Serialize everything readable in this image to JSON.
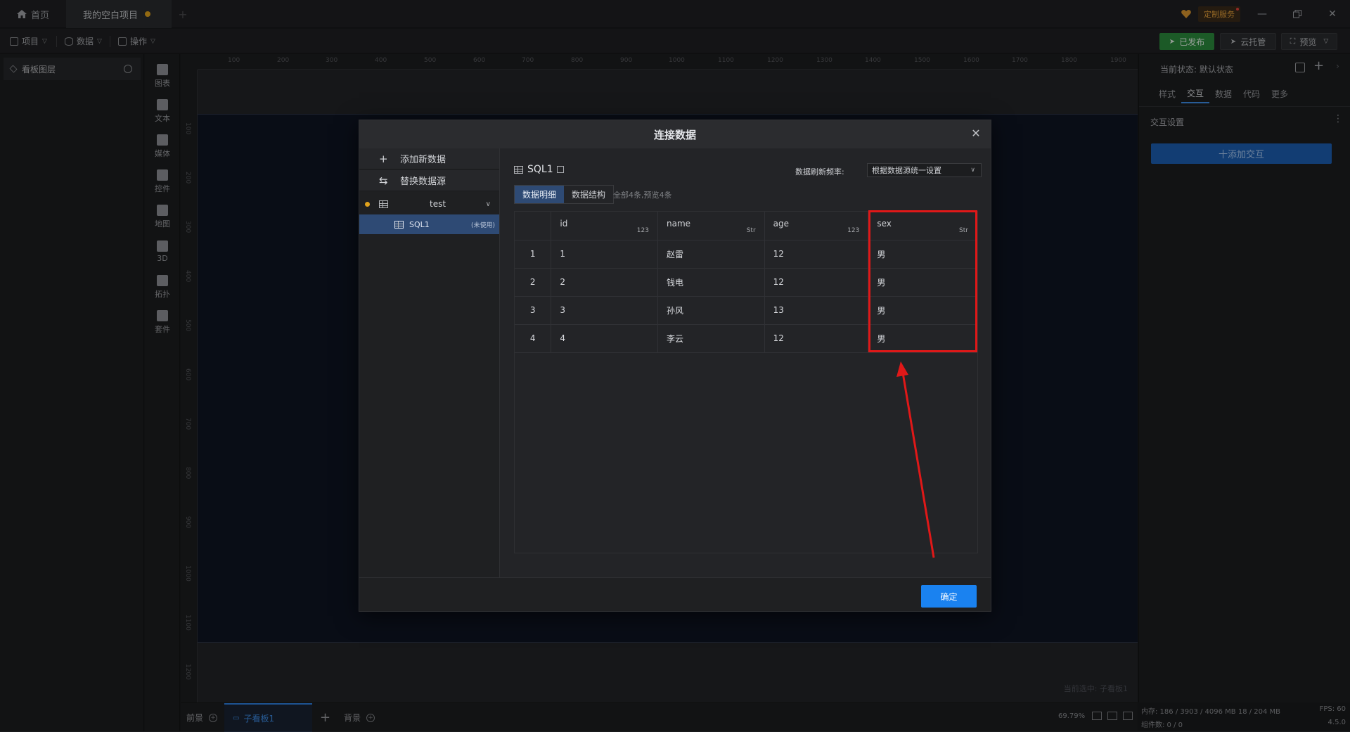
{
  "titlebar": {
    "home_tab": "首页",
    "project_tab": "我的空白项目",
    "custom_service": "定制服务"
  },
  "toolbar": {
    "menu_project": "项目",
    "menu_data": "数据",
    "menu_operate": "操作",
    "published": "已发布",
    "cloud_host": "云托管",
    "preview": "预览"
  },
  "layers": {
    "title": "看板图层"
  },
  "components": [
    {
      "label": "图表",
      "icon": "chart-icon"
    },
    {
      "label": "文本",
      "icon": "text-icon"
    },
    {
      "label": "媒体",
      "icon": "media-icon"
    },
    {
      "label": "控件",
      "icon": "control-icon"
    },
    {
      "label": "地图",
      "icon": "map-icon"
    },
    {
      "label": "3D",
      "icon": "cube-icon"
    },
    {
      "label": "拓扑",
      "icon": "topology-icon"
    },
    {
      "label": "套件",
      "icon": "suite-icon"
    }
  ],
  "ruler": {
    "top": [
      "100",
      "200",
      "300",
      "400",
      "500",
      "600",
      "700",
      "800",
      "900",
      "1000",
      "1100",
      "1200",
      "1300",
      "1400",
      "1500",
      "1600",
      "1700",
      "1800",
      "1900"
    ],
    "left": [
      "100",
      "200",
      "300",
      "400",
      "500",
      "600",
      "700",
      "800",
      "900",
      "1000",
      "1100",
      "1200"
    ]
  },
  "canvas": {
    "selected_label": "当前选中: 子看板1"
  },
  "bottom": {
    "front": "前景",
    "sub_board": "子看板1",
    "background": "背景",
    "zoom": "69.79%",
    "memory": "内存: 186 / 3903 / 4096 MB  18 / 204 MB",
    "fps": "FPS: 60",
    "components": "组件数: 0 / 0",
    "version": "4.5.0"
  },
  "right_panel": {
    "state": "当前状态: 默认状态",
    "tabs": [
      "样式",
      "交互",
      "数据",
      "代码",
      "更多"
    ],
    "active_tab": "交互",
    "section": "交互设置",
    "add_interaction": "十添加交互"
  },
  "modal": {
    "title": "连接数据",
    "add_data": "添加新数据",
    "replace_source": "替换数据源",
    "source_name": "test",
    "sql_name": "SQL1",
    "sql_status": "(未使用)",
    "sql_title": "SQL1",
    "refresh_label": "数据刷新频率:",
    "refresh_value": "根据数据源统一设置",
    "tab_detail": "数据明细",
    "tab_structure": "数据结构",
    "count": "全部4条,预览4条",
    "ok": "确定",
    "columns": [
      {
        "name": "id",
        "type": "123"
      },
      {
        "name": "name",
        "type": "Str"
      },
      {
        "name": "age",
        "type": "123"
      },
      {
        "name": "sex",
        "type": "Str"
      }
    ],
    "rows": [
      {
        "idx": "1",
        "id": "1",
        "name": "赵雷",
        "age": "12",
        "sex": "男"
      },
      {
        "idx": "2",
        "id": "2",
        "name": "钱电",
        "age": "12",
        "sex": "男"
      },
      {
        "idx": "3",
        "id": "3",
        "name": "孙风",
        "age": "13",
        "sex": "男"
      },
      {
        "idx": "4",
        "id": "4",
        "name": "李云",
        "age": "12",
        "sex": "男"
      }
    ]
  },
  "colors": {
    "accent": "#1a82f0",
    "published": "#2c8a3c",
    "annotation": "#e01818",
    "unsaved_dot": "#e0a21c"
  }
}
